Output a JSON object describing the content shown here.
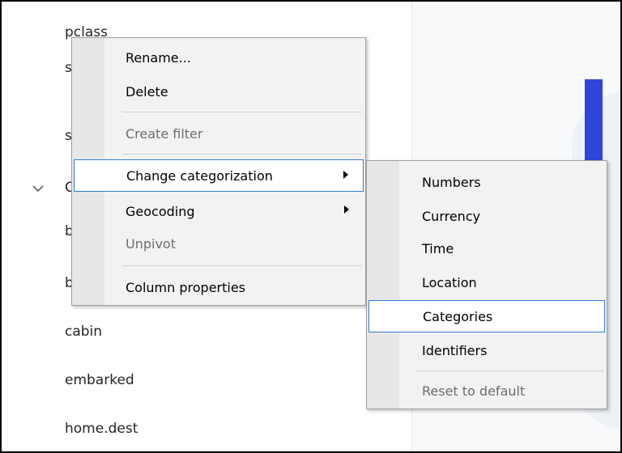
{
  "fields": [
    {
      "label": "pclass"
    },
    {
      "label": "s"
    },
    {
      "label": "s"
    },
    {
      "label": "b"
    },
    {
      "label": "b"
    },
    {
      "label": "cabin"
    },
    {
      "label": "embarked"
    },
    {
      "label": "home.dest"
    }
  ],
  "group_prefix": "C",
  "context_menu": {
    "items": [
      {
        "label": "Rename...",
        "enabled": true
      },
      {
        "label": "Delete",
        "enabled": true
      },
      {
        "label": "Create filter",
        "enabled": false
      },
      {
        "label": "Change categorization",
        "enabled": true,
        "has_submenu": true,
        "selected": true
      },
      {
        "label": "Geocoding",
        "enabled": true,
        "has_submenu": true
      },
      {
        "label": "Unpivot",
        "enabled": false
      },
      {
        "label": "Column properties",
        "enabled": true
      }
    ]
  },
  "submenu": {
    "items": [
      {
        "label": "Numbers",
        "enabled": true
      },
      {
        "label": "Currency",
        "enabled": true
      },
      {
        "label": "Time",
        "enabled": true
      },
      {
        "label": "Location",
        "enabled": true
      },
      {
        "label": "Categories",
        "enabled": true,
        "selected": true
      },
      {
        "label": "Identifiers",
        "enabled": true
      },
      {
        "label": "Reset to default",
        "enabled": false
      }
    ]
  },
  "colors": {
    "accent_bar": "#2f44d8",
    "selection_border": "#3379d9",
    "menu_background": "#f2f2f2"
  }
}
